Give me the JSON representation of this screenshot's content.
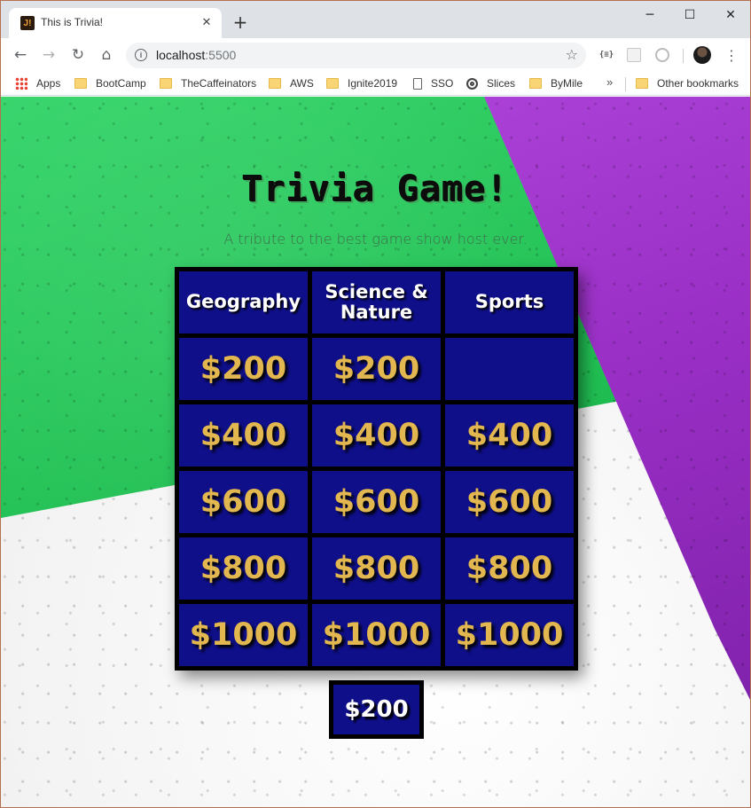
{
  "browser": {
    "tab_title": "This is Trivia!",
    "tab_favicon_text": "J!",
    "tab_close": "✕",
    "new_tab": "+",
    "window_controls": {
      "minimize": "─",
      "maximize": "☐",
      "close": "✕"
    },
    "url_host": "localhost",
    "url_port": ":5500",
    "ext_json_label": "{≡}",
    "bookmarks": [
      {
        "label": "Apps",
        "icon": "apps-grid-icon"
      },
      {
        "label": "BootCamp",
        "icon": "folder-icon"
      },
      {
        "label": "TheCaffeinators",
        "icon": "folder-icon"
      },
      {
        "label": "AWS",
        "icon": "folder-icon"
      },
      {
        "label": "Ignite2019",
        "icon": "folder-icon"
      },
      {
        "label": "SSO",
        "icon": "page-icon"
      },
      {
        "label": "Slices",
        "icon": "slices-icon"
      },
      {
        "label": "ByMile",
        "icon": "folder-icon"
      }
    ],
    "bookmarks_more": "»",
    "other_bookmarks": "Other bookmarks"
  },
  "game": {
    "title": "Trivia Game!",
    "subtitle": "A tribute to the best game show host ever.",
    "categories": [
      "Geography",
      "Science & Nature",
      "Sports"
    ],
    "rows": [
      [
        "$200",
        "$200",
        ""
      ],
      [
        "$400",
        "$400",
        "$400"
      ],
      [
        "$600",
        "$600",
        "$600"
      ],
      [
        "$800",
        "$800",
        "$800"
      ],
      [
        "$1000",
        "$1000",
        "$1000"
      ]
    ],
    "current_value": "$200"
  },
  "colors": {
    "board_cell": "#0f0f8a",
    "value_text": "#e2b74f",
    "category_text": "#ffffff",
    "green_bg": "#1fc052",
    "purple_bg": "#9a2fc6"
  }
}
